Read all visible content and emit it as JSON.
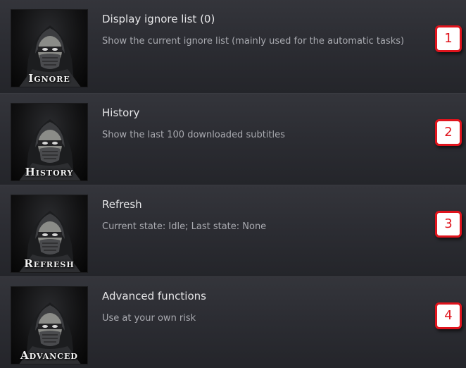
{
  "items": [
    {
      "title": "Display ignore list (0)",
      "description": "Show the current ignore list (mainly used for the automatic tasks)",
      "thumb_label": "Ignore",
      "thumb_icon": "masked-ninja-icon",
      "badge": "1"
    },
    {
      "title": "History",
      "description": "Show the last 100 downloaded subtitles",
      "thumb_label": "History",
      "thumb_icon": "masked-ninja-icon",
      "badge": "2"
    },
    {
      "title": "Refresh",
      "description": "Current state: Idle; Last state: None",
      "thumb_label": "Refresh",
      "thumb_icon": "masked-ninja-icon",
      "badge": "3"
    },
    {
      "title": "Advanced functions",
      "description": "Use at your own risk",
      "thumb_label": "Advanced",
      "thumb_icon": "masked-ninja-icon",
      "badge": "4"
    }
  ],
  "colors": {
    "badge_red": "#e0141d",
    "background": "#26272c"
  }
}
